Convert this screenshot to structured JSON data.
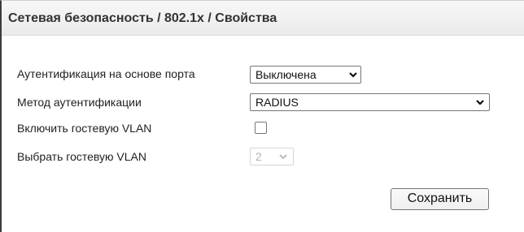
{
  "header": {
    "title": "Сетевая безопасность / 802.1x / Свойства"
  },
  "form": {
    "port_auth": {
      "label": "Аутентификация на основе порта",
      "value": "Выключена"
    },
    "auth_method": {
      "label": "Метод аутентификации",
      "value": "RADIUS"
    },
    "guest_vlan_enable": {
      "label": "Включить гостевую VLAN",
      "checked": false
    },
    "guest_vlan_select": {
      "label": "Выбрать гостевую VLAN",
      "value": "2",
      "disabled": true
    },
    "save_label": "Сохранить"
  },
  "icons": {
    "dropdown": "chevron-down-icon",
    "checkbox": "checkbox-icon"
  },
  "colors": {
    "header_bg": "#ebebeb",
    "disabled_text": "#b5b5b5",
    "border": "#767676"
  }
}
